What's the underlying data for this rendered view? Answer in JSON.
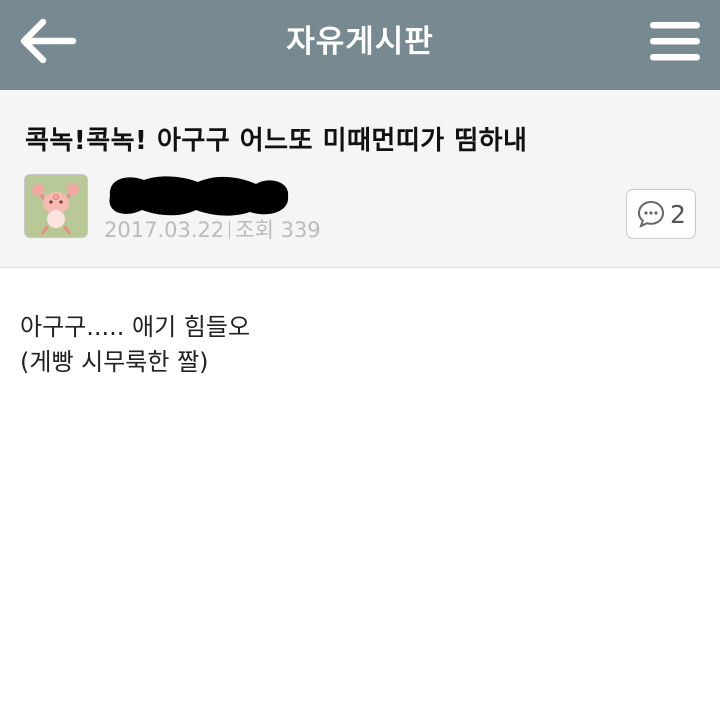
{
  "header": {
    "title": "자유게시판",
    "back_icon": "arrow-left-icon",
    "menu_icon": "hamburger-menu-icon",
    "background_color": "#778a91"
  },
  "post": {
    "title": "콕녹!콕녹! 아구구 어느또 미때먼띠가 띰하내",
    "date": "2017.03.22",
    "views_label": "조회",
    "views": "339",
    "comment_count": "2",
    "comment_icon": "speech-bubble-icon",
    "body_lines": [
      "아구구..... 애기 힘들오",
      "(게빵 시무룩한 짤)"
    ]
  }
}
